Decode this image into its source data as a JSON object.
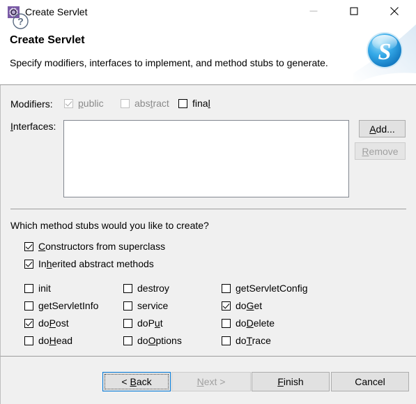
{
  "window": {
    "title": "Create Servlet",
    "icon": "gear-icon",
    "controls": {
      "minimize": "—",
      "maximize": "□",
      "close": "✕"
    }
  },
  "header": {
    "title": "Create Servlet",
    "description": "Specify modifiers, interfaces to implement, and method stubs to generate.",
    "logo": "blue-s-badge"
  },
  "modifiers": {
    "label": "Modifiers:",
    "options": [
      {
        "label": "public",
        "mnemonic": "p",
        "checked": true,
        "enabled": false
      },
      {
        "label": "abstract",
        "mnemonic": "t",
        "checked": false,
        "enabled": false
      },
      {
        "label": "final",
        "mnemonic": "l",
        "checked": false,
        "enabled": true
      }
    ]
  },
  "interfaces": {
    "label": "Interfaces:",
    "mnemonic": "I",
    "items": [],
    "add_label": "Add...",
    "add_mnemonic": "A",
    "add_enabled": true,
    "remove_label": "Remove",
    "remove_mnemonic": "R",
    "remove_enabled": false
  },
  "stubs": {
    "prompt": "Which method stubs would you like to create?",
    "top_options": [
      {
        "label": "Constructors from superclass",
        "mnemonic": "C",
        "checked": true
      },
      {
        "label": "Inherited abstract methods",
        "mnemonic": "h",
        "checked": true
      }
    ],
    "columns": [
      [
        {
          "label": "init",
          "mnemonic": "",
          "checked": false
        },
        {
          "label": "getServletInfo",
          "mnemonic": "",
          "checked": false
        },
        {
          "label": "doPost",
          "mnemonic": "P",
          "checked": true
        },
        {
          "label": "doHead",
          "mnemonic": "H",
          "checked": false
        }
      ],
      [
        {
          "label": "destroy",
          "mnemonic": "",
          "checked": false
        },
        {
          "label": "service",
          "mnemonic": "",
          "checked": false
        },
        {
          "label": "doPut",
          "mnemonic": "u",
          "checked": false
        },
        {
          "label": "doOptions",
          "mnemonic": "O",
          "checked": false
        }
      ],
      [
        {
          "label": "getServletConfig",
          "mnemonic": "",
          "checked": false
        },
        {
          "label": "doGet",
          "mnemonic": "G",
          "checked": true
        },
        {
          "label": "doDelete",
          "mnemonic": "D",
          "checked": false
        },
        {
          "label": "doTrace",
          "mnemonic": "T",
          "checked": false
        }
      ]
    ]
  },
  "footer": {
    "help_icon": "help-question-icon",
    "buttons": [
      {
        "name": "back",
        "label": "< Back",
        "mnemonic": "B",
        "enabled": true,
        "default": true
      },
      {
        "name": "next",
        "label": "Next >",
        "mnemonic": "N",
        "enabled": false,
        "default": false
      },
      {
        "name": "finish",
        "label": "Finish",
        "mnemonic": "F",
        "enabled": true,
        "default": false
      },
      {
        "name": "cancel",
        "label": "Cancel",
        "mnemonic": "",
        "enabled": true,
        "default": false
      }
    ]
  },
  "colors": {
    "dialog_bg": "#f0f0f0",
    "header_bg": "#ffffff",
    "accent_blue": "#0078d7",
    "logo_blue": "#1a9ede",
    "icon_purple": "#7a5ba6",
    "disabled_text": "#8a8a8a"
  }
}
